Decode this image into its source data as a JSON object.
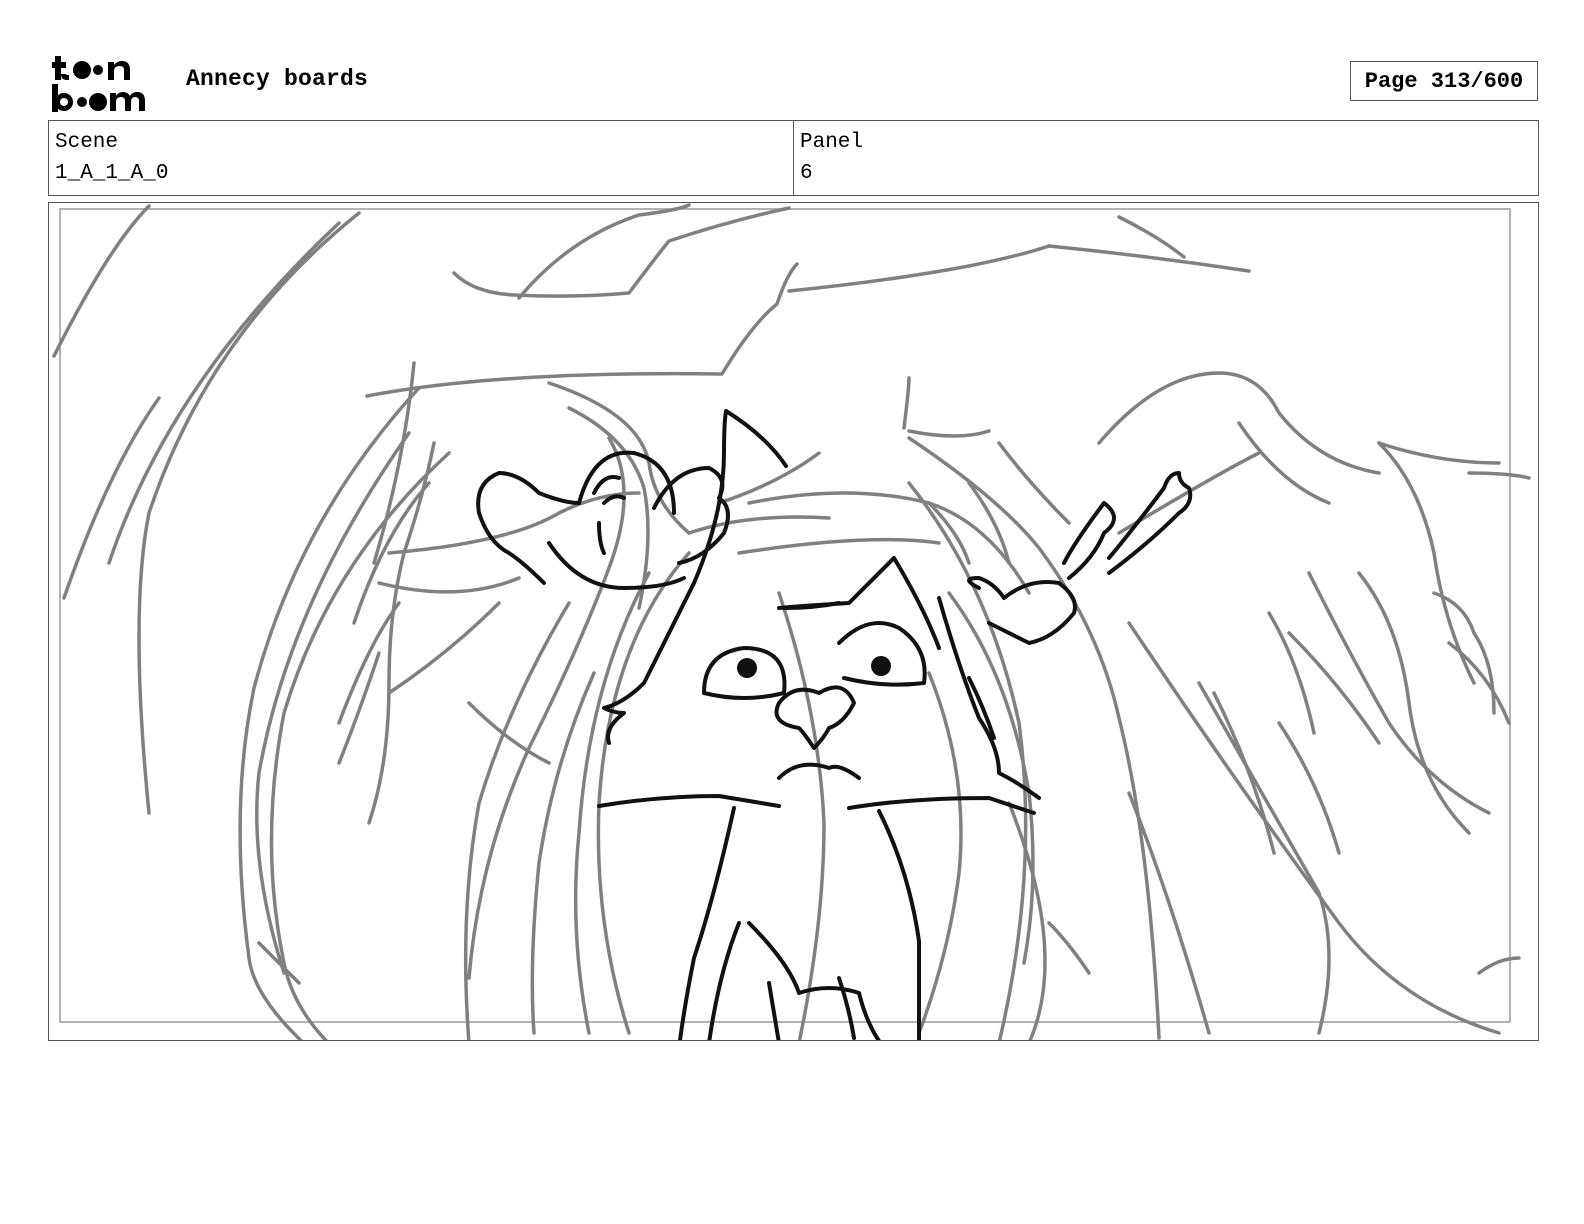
{
  "header": {
    "logo_text": "toon boom",
    "title": "Annecy boards",
    "page_label": "Page 313/600"
  },
  "info": {
    "scene_label": "Scene",
    "scene_value": "1_A_1_A_0",
    "panel_label": "Panel",
    "panel_value": "6"
  },
  "panel": {
    "description": "",
    "colors": {
      "background_lines": "#808080",
      "character_lines": "#111111",
      "frame": "#555555"
    }
  }
}
